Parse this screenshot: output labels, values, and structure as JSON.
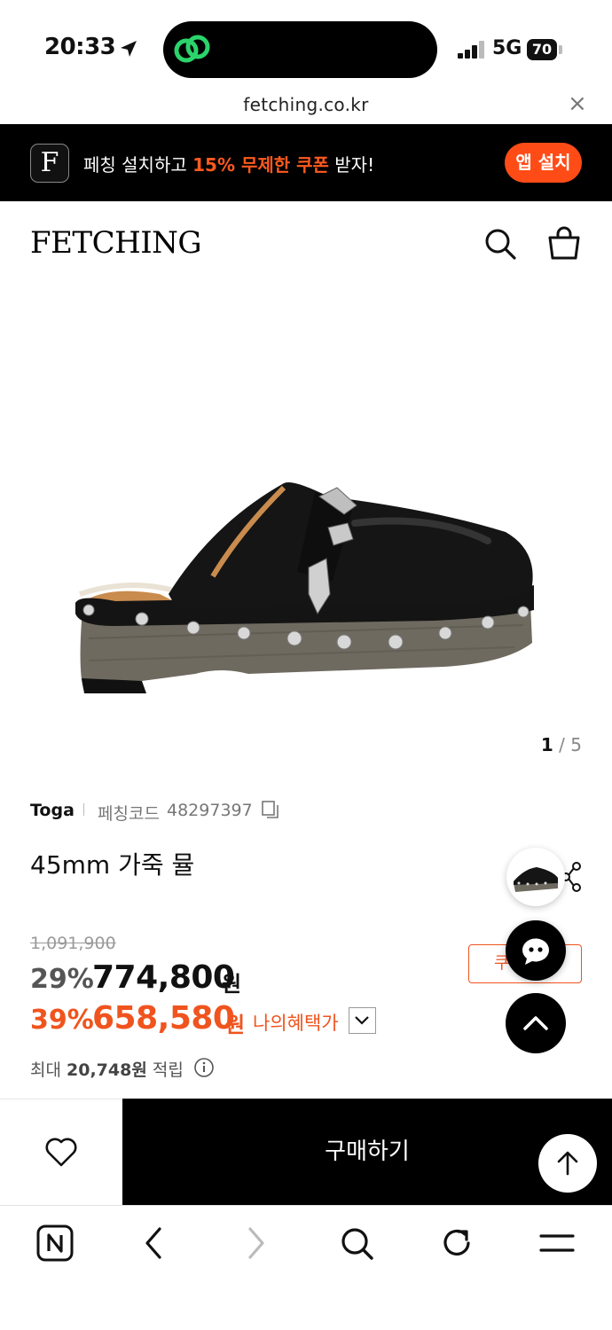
{
  "status_bar": {
    "time": "20:33",
    "network": "5G",
    "battery": "70",
    "icons": [
      "location-arrow-icon",
      "signal-icon",
      "battery-icon"
    ]
  },
  "browser": {
    "url": "fetching.co.kr",
    "close_glyph": "×"
  },
  "promo_banner": {
    "app_icon_letter": "F",
    "text_before": "페칭 설치하고 ",
    "text_highlight": "15% 무제한 쿠폰",
    "text_after": " 받자!",
    "install_label": "앱 설치"
  },
  "header": {
    "logo": "FETCHING",
    "icons": [
      "search-icon",
      "shopping-bag-icon"
    ]
  },
  "gallery": {
    "current": "1",
    "separator": "/",
    "total": "5"
  },
  "product": {
    "brand": "Toga",
    "code_label": "페칭코드",
    "code_value": "48297397",
    "title": "45mm 가죽 뮬",
    "original_price": "1,091,900",
    "discount_rate": "29%",
    "price": "774,800",
    "currency": "원",
    "benefit_discount_rate": "39%",
    "benefit_price": "658,580",
    "benefit_label": "나의혜택가",
    "coupon_label": "쿠폰받기",
    "points_prefix": "최대 ",
    "points_value": "20,748원",
    "points_suffix": " 적립"
  },
  "purchase_bar": {
    "buy_label": "구매하기"
  },
  "colors": {
    "accent": "#f0541e",
    "install_button": "#ff4c17",
    "banner_bg": "#000000",
    "buy_bg": "#000000"
  }
}
